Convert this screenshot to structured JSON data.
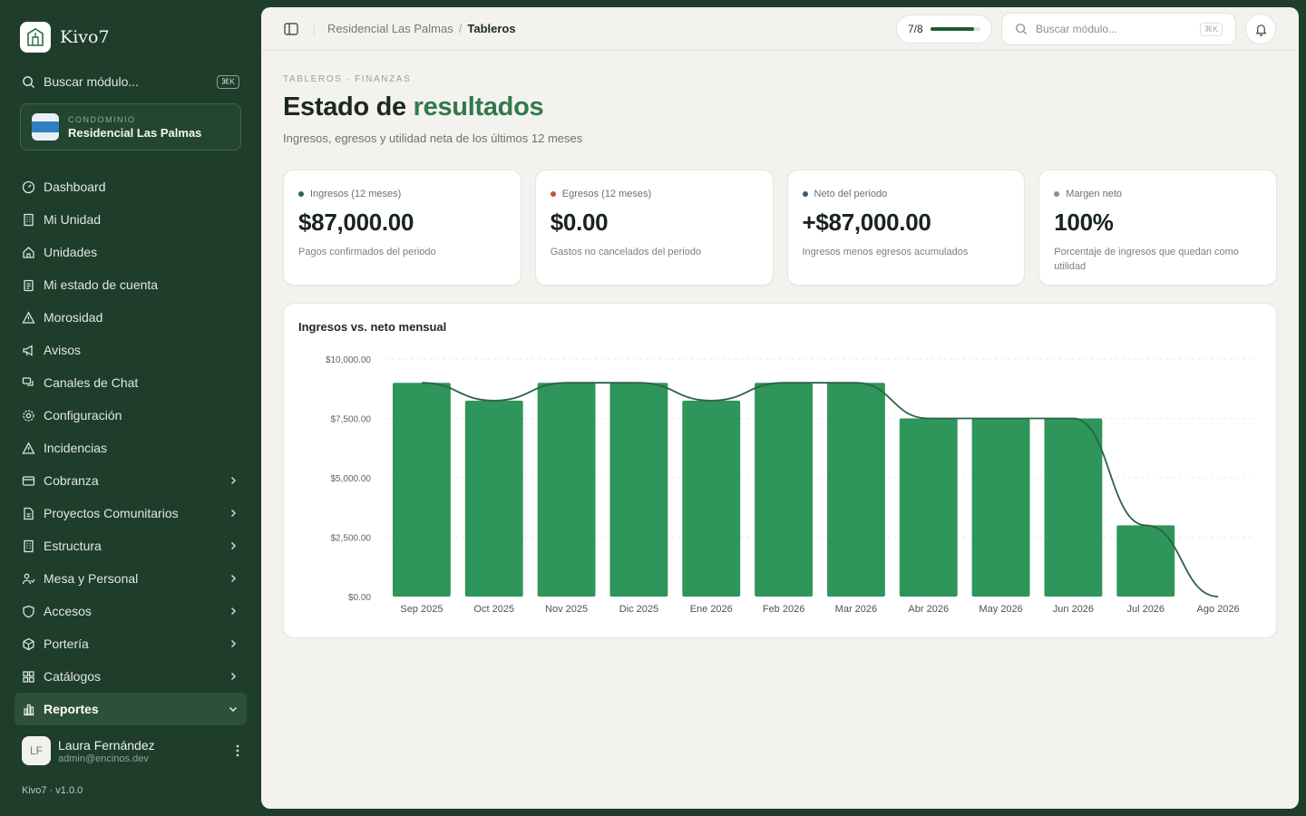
{
  "brand": {
    "name": "Kivo7"
  },
  "sidebar": {
    "search_label": "Buscar módulo...",
    "search_kbd": "⌘K",
    "condo_kicker": "CONDOMINIO",
    "condo_name": "Residencial Las Palmas",
    "items": [
      {
        "label": "Dashboard",
        "icon": "gauge-icon",
        "chevron": false
      },
      {
        "label": "Mi Unidad",
        "icon": "building-icon",
        "chevron": false
      },
      {
        "label": "Unidades",
        "icon": "home-icon",
        "chevron": false
      },
      {
        "label": "Mi estado de cuenta",
        "icon": "clipboard-icon",
        "chevron": false
      },
      {
        "label": "Morosidad",
        "icon": "warning-icon",
        "chevron": false
      },
      {
        "label": "Avisos",
        "icon": "megaphone-icon",
        "chevron": false
      },
      {
        "label": "Canales de Chat",
        "icon": "chat-icon",
        "chevron": false
      },
      {
        "label": "Configuración",
        "icon": "gear-icon",
        "chevron": false
      },
      {
        "label": "Incidencias",
        "icon": "warning-icon",
        "chevron": false
      },
      {
        "label": "Cobranza",
        "icon": "card-icon",
        "chevron": true
      },
      {
        "label": "Proyectos Comunitarios",
        "icon": "document-icon",
        "chevron": true
      },
      {
        "label": "Estructura",
        "icon": "building-icon",
        "chevron": true
      },
      {
        "label": "Mesa y Personal",
        "icon": "people-icon",
        "chevron": true
      },
      {
        "label": "Accesos",
        "icon": "shield-icon",
        "chevron": true
      },
      {
        "label": "Portería",
        "icon": "box-icon",
        "chevron": true
      },
      {
        "label": "Catálogos",
        "icon": "grid-icon",
        "chevron": true
      },
      {
        "label": "Reportes",
        "icon": "bar-chart-icon",
        "chevron": "down",
        "active": true
      }
    ],
    "user": {
      "initials": "LF",
      "name": "Laura Fernández",
      "email": "admin@encinos.dev"
    },
    "version": "Kivo7 · v1.0.0"
  },
  "topbar": {
    "breadcrumb_parent": "Residencial Las Palmas",
    "breadcrumb_sep": "/",
    "breadcrumb_current": "Tableros",
    "progress_label": "7/8",
    "progress_fraction": 0.875,
    "search_placeholder": "Buscar módulo...",
    "search_kbd": "⌘K"
  },
  "page": {
    "kicker": "TABLEROS · FINANZAS",
    "title_main": "Estado de ",
    "title_accent": "resultados",
    "subtitle": "Ingresos, egresos y utilidad neta de los últimos 12 meses"
  },
  "cards": [
    {
      "label": "Ingresos (12 meses)",
      "value": "$87,000.00",
      "desc": "Pagos confirmados del periodo",
      "dot_color": "#2f6b45"
    },
    {
      "label": "Egresos (12 meses)",
      "value": "$0.00",
      "desc": "Gastos no cancelados del periodo",
      "dot_color": "#c0553a"
    },
    {
      "label": "Neto del periodo",
      "value": "+$87,000.00",
      "desc": "Ingresos menos egresos acumulados",
      "dot_color": "#3a5a70"
    },
    {
      "label": "Margen neto",
      "value": "100%",
      "desc": "Porcentaje de ingresos que quedan como utilidad",
      "dot_color": "#8a8f8b"
    }
  ],
  "colors": {
    "accent": "#2f7a4b",
    "bar": "#2e955b",
    "line": "#2a6442"
  },
  "chart_data": {
    "type": "bar",
    "title": "Ingresos vs. neto mensual",
    "categories": [
      "Sep 2025",
      "Oct 2025",
      "Nov 2025",
      "Dic 2025",
      "Ene 2026",
      "Feb 2026",
      "Mar 2026",
      "Abr 2026",
      "May 2026",
      "Jun 2026",
      "Jul 2026",
      "Ago 2026"
    ],
    "series": [
      {
        "type": "bar",
        "values": [
          9000,
          8250,
          9000,
          9000,
          8250,
          9000,
          9000,
          7500,
          7500,
          7500,
          3000,
          0
        ]
      },
      {
        "type": "line",
        "values": [
          9000,
          8250,
          9000,
          9000,
          8250,
          9000,
          9000,
          7500,
          7500,
          7500,
          3000,
          0
        ]
      }
    ],
    "ylim": [
      0,
      10000
    ],
    "yticks": [
      "$0.00",
      "$2,500.00",
      "$5,000.00",
      "$7,500.00",
      "$10,000.00"
    ],
    "ytick_values": [
      0,
      2500,
      5000,
      7500,
      10000
    ],
    "grid": true
  }
}
